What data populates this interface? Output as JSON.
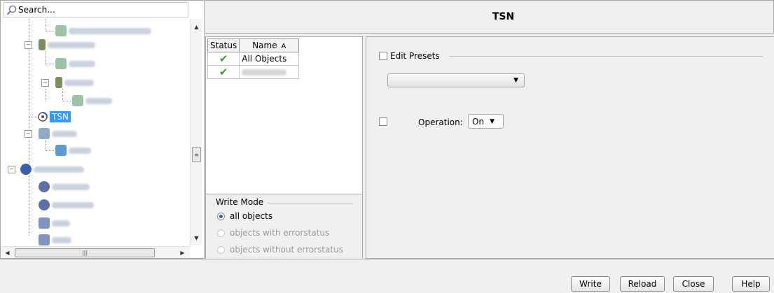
{
  "search": {
    "placeholder": "Search..."
  },
  "tree": {
    "selected_label": "TSN"
  },
  "header": {
    "title": "TSN"
  },
  "object_table": {
    "columns": [
      "Status",
      "Name"
    ],
    "sort_indicator": "A",
    "rows": [
      {
        "status": "✔",
        "name": "All Objects"
      },
      {
        "status": "✔",
        "name": ""
      }
    ]
  },
  "write_mode": {
    "title": "Write Mode",
    "options": [
      "all objects",
      "objects with errorstatus",
      "objects without errorstatus"
    ],
    "selected": "all objects"
  },
  "settings": {
    "edit_presets_label": "Edit Presets",
    "preset_value": "",
    "operation_label": "Operation:",
    "operation_value": "On"
  },
  "footer": {
    "buttons": [
      "Write",
      "Reload",
      "Close",
      "Help"
    ]
  },
  "colors": {
    "selection": "#3399ff",
    "check": "#3aa02a"
  },
  "icons": {
    "search": "search-icon",
    "dropdown": "chevron-down-icon",
    "check": "check-icon"
  }
}
